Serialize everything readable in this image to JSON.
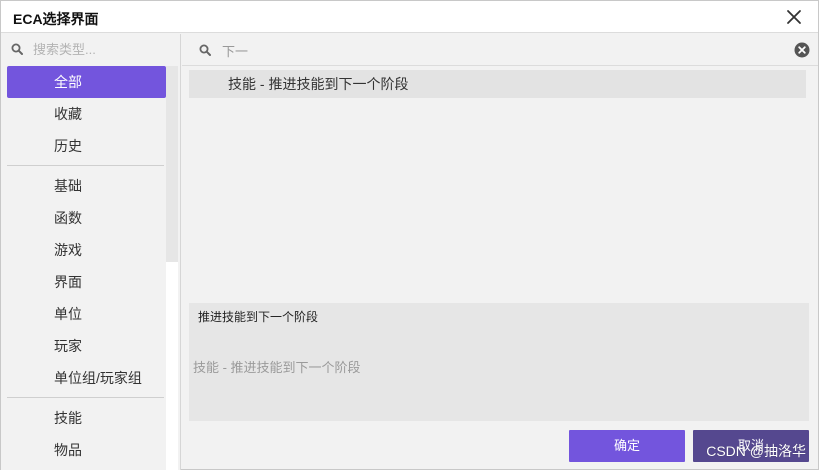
{
  "window": {
    "title": "ECA选择界面"
  },
  "sidebar": {
    "search_placeholder": "搜索类型...",
    "items": [
      {
        "label": "全部",
        "active": true
      },
      {
        "label": "收藏"
      },
      {
        "label": "历史"
      },
      {
        "label": "基础"
      },
      {
        "label": "函数"
      },
      {
        "label": "游戏"
      },
      {
        "label": "界面"
      },
      {
        "label": "单位"
      },
      {
        "label": "玩家"
      },
      {
        "label": "单位组/玩家组"
      },
      {
        "label": "技能"
      },
      {
        "label": "物品"
      }
    ]
  },
  "main": {
    "search_value": "下一",
    "results": [
      {
        "label": "技能 - 推进技能到下一个阶段",
        "selected": true
      }
    ],
    "description": {
      "title": "推进技能到下一个阶段",
      "body": "技能 - 推进技能到下一个阶段"
    }
  },
  "buttons": {
    "ok": "确定",
    "cancel": "取消"
  },
  "watermark": "CSDN @抽洛华",
  "colors": {
    "accent": "#7355dd",
    "cancel": "#55488f",
    "selected_row": "#e3e3e3"
  }
}
